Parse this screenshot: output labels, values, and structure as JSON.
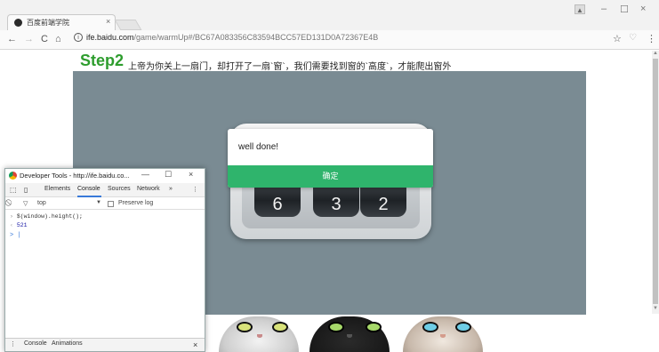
{
  "browser": {
    "tab_title": "百度前端学院",
    "tab_close": "×",
    "profile_icon": "user-icon",
    "window_controls": [
      "–",
      "☐",
      "×"
    ],
    "nav": {
      "back": "←",
      "forward": "→",
      "reload": "C",
      "home": "⌂"
    },
    "url_host": "ife.baidu.com",
    "url_path": "/game/warmUp#/BC67A083356C83594BCC57ED131D0A72367E4B",
    "star": "☆",
    "extension": "♡",
    "menu": "⋮"
  },
  "page": {
    "step_title": "Step2",
    "step_desc": "上帝为你关上一扇门，却打开了一扇`窗`，我们需要找到窗的`高度`，才能爬出窗外",
    "lock_digits": [
      "6",
      "3",
      "2"
    ],
    "alert_message": "well done!",
    "alert_button": "确定"
  },
  "devtools": {
    "title": "Developer Tools - http://ife.baidu.co...",
    "window_controls": [
      "—",
      "☐",
      "×"
    ],
    "tabs": [
      "Elements",
      "Console",
      "Sources",
      "Network",
      "»"
    ],
    "active_tab": "Console",
    "context": "top",
    "preserve_log": "Preserve log",
    "command": "$(window).height();",
    "result": "521",
    "prompt": ">",
    "drawer_tabs": [
      "Console",
      "Animations"
    ],
    "drawer_close": "×"
  },
  "colors": {
    "accent_green": "#2fb46c",
    "step_green": "#2e9d2e",
    "stage_bg": "#7a8b93"
  }
}
